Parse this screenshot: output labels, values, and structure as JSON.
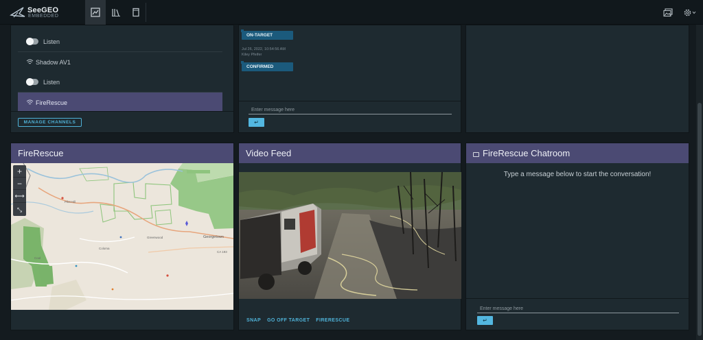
{
  "app": {
    "brand": "SeeGEO",
    "brand_sub": "EMBEDDED"
  },
  "nav": {
    "items": [
      {
        "icon": "chart-icon",
        "active": true
      },
      {
        "icon": "library-icon",
        "active": false
      },
      {
        "icon": "document-icon",
        "active": false
      }
    ],
    "right_icons": [
      "image-gallery-icon",
      "gear-icon"
    ]
  },
  "channels": {
    "rows": [
      {
        "type": "toggle",
        "label": "Listen"
      },
      {
        "type": "channel",
        "label": "Shadow AV1"
      },
      {
        "type": "toggle",
        "label": "Listen"
      },
      {
        "type": "channel",
        "label": "FireRescue",
        "active": true
      }
    ],
    "manage_label": "MANAGE CHANNELS"
  },
  "messages": {
    "items": [
      {
        "status": "ON-TARGET"
      },
      {
        "timestamp": "Jul 26, 2022, 10:54:56 AM",
        "author": "Kiley Pfeifer",
        "status": "CONFIRMED"
      }
    ],
    "input_placeholder": "Enter message here",
    "send_glyph": "↵"
  },
  "map_panel": {
    "title": "FireRescue",
    "zoom_in": "+",
    "zoom_out": "−",
    "pan": "⟷",
    "fit": "⤡",
    "places": [
      "Georgetown",
      "CA 193",
      "Pilot Hill",
      "Coloma",
      "Cool",
      "Greenwood"
    ]
  },
  "video_panel": {
    "title": "Video Feed",
    "actions": [
      "SNAP",
      "GO OFF TARGET",
      "FIRERESCUE"
    ]
  },
  "chat_panel": {
    "title": "FireRescue Chatroom",
    "empty_message": "Type a message below to start the conversation!",
    "input_placeholder": "Enter message here",
    "send_glyph": "↵"
  },
  "colors": {
    "header_bar": "#4b4a73",
    "accent": "#4fb3d9",
    "badge": "#1b5a7c",
    "panel_bg": "#1e2a30"
  }
}
